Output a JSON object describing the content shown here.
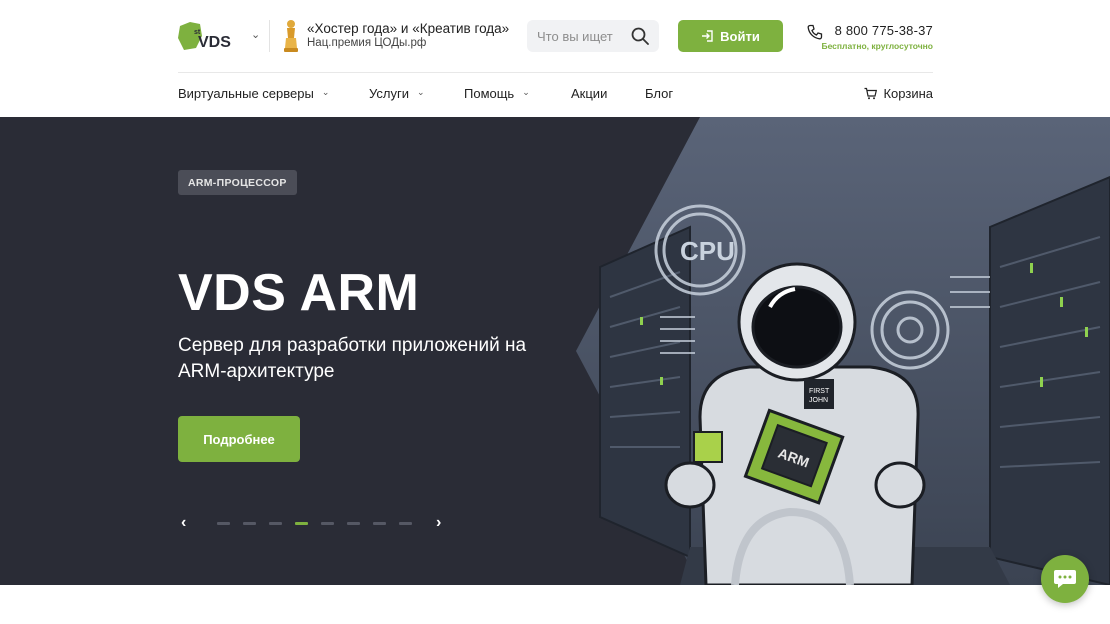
{
  "header": {
    "logo_text": "1st VDS",
    "award_title": "«Хостер года» и «Креатив года»",
    "award_subtitle": "Нац.премия ЦОДы.рф",
    "search_placeholder": "Что вы ищет",
    "login_label": "Войти",
    "phone": "8 800 775-38-37",
    "phone_note": "Бесплатно, круглосуточно"
  },
  "nav": {
    "items": [
      {
        "label": "Виртуальные серверы",
        "has_dropdown": true
      },
      {
        "label": "Услуги",
        "has_dropdown": true
      },
      {
        "label": "Помощь",
        "has_dropdown": true
      },
      {
        "label": "Акции",
        "has_dropdown": false
      },
      {
        "label": "Блог",
        "has_dropdown": false
      }
    ],
    "cart_label": "Корзина"
  },
  "hero": {
    "badge": "ARM-ПРОЦЕССОР",
    "title": "VDS ARM",
    "subtitle": "Сервер для разработки приложений на ARM-архитектуре",
    "button_label": "Подробнее",
    "slides_total": 8,
    "slide_active": 4
  },
  "colors": {
    "accent": "#7eb13f",
    "hero_bg": "#2a2c36",
    "badge_bg": "#4b4d57"
  },
  "icons": {
    "search": "search-icon",
    "login": "login-icon",
    "phone": "phone-icon",
    "cart": "cart-icon",
    "chat": "chat-icon",
    "award": "award-icon"
  }
}
